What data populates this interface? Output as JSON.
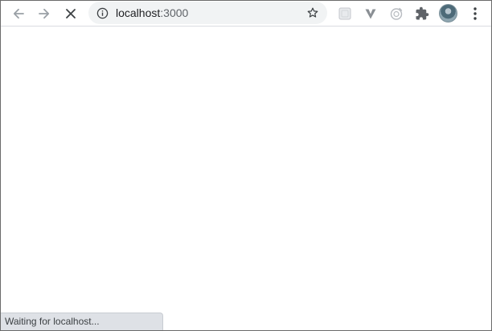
{
  "toolbar": {
    "back_icon": "arrow-left-icon",
    "forward_icon": "arrow-right-icon",
    "stop_icon": "close-icon",
    "omnibox": {
      "info_icon": "info-icon",
      "host": "localhost",
      "port": ":3000",
      "bookmark_icon": "star-icon"
    },
    "extensions": [
      "extension-icon",
      "extension-icon",
      "extension-icon"
    ],
    "puzzle_icon": "puzzle-icon",
    "menu_icon": "kebab-menu-icon"
  },
  "colors": {
    "toolbar_bg": "#ffffff",
    "omnibox_bg": "#f1f3f4",
    "icon_gray": "#5f6368",
    "status_bg": "#dee1e6"
  },
  "status": {
    "text": "Waiting for localhost..."
  }
}
